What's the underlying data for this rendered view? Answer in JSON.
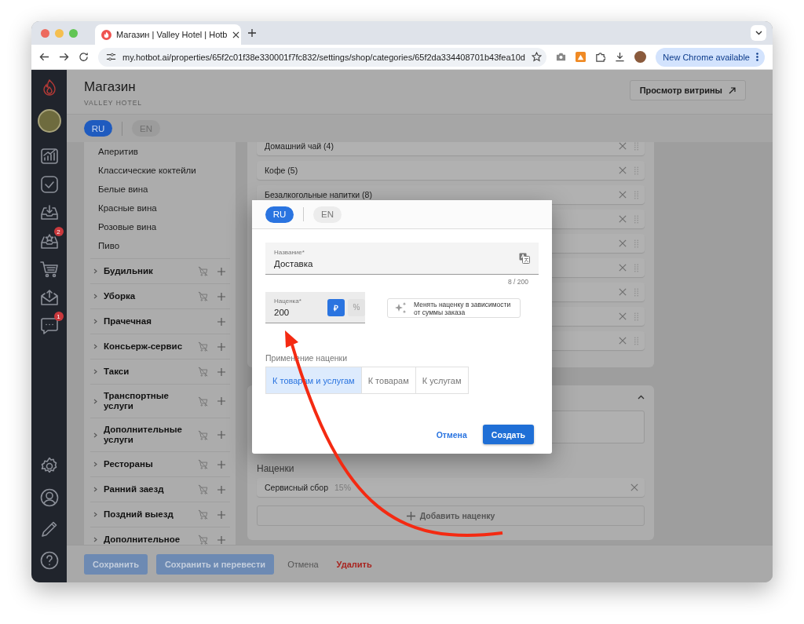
{
  "browser": {
    "tab_title": "Магазин | Valley Hotel | Hotb",
    "url": "my.hotbot.ai/properties/65f2c01f38e330001f7fc832/settings/shop/categories/65f2da334408701b43fea10d",
    "update_button": "New Chrome available"
  },
  "nav": {
    "top": [
      {
        "kind": "chart"
      },
      {
        "kind": "check"
      },
      {
        "kind": "inbox"
      },
      {
        "kind": "star-tray",
        "badge": "2"
      },
      {
        "kind": "cart"
      },
      {
        "kind": "mail"
      },
      {
        "kind": "chat",
        "badge": "1"
      }
    ],
    "bottom": [
      {
        "kind": "settings"
      },
      {
        "kind": "user"
      },
      {
        "kind": "pencil"
      },
      {
        "kind": "help"
      }
    ]
  },
  "header": {
    "title": "Магазин",
    "subtitle": "VALLEY HOTEL",
    "storefront_button": "Просмотр витрины"
  },
  "languages": [
    {
      "label": "RU",
      "selected": true
    },
    {
      "label": "EN",
      "selected": false
    }
  ],
  "categories": {
    "subitems": [
      "Аперитив",
      "Классические коктейли",
      "Белые вина",
      "Красные вина",
      "Розовые вина",
      "Пиво"
    ],
    "groups": [
      {
        "label": "Будильник",
        "hidden_in_shop": true
      },
      {
        "label": "Уборка",
        "hidden_in_shop": true
      },
      {
        "label": "Прачечная",
        "hidden_in_shop": false
      },
      {
        "label": "Консьерж-сервис",
        "hidden_in_shop": true
      },
      {
        "label": "Такси",
        "hidden_in_shop": true
      },
      {
        "label": "Транспортные услуги",
        "hidden_in_shop": true
      },
      {
        "label": "Дополнительные услуги",
        "hidden_in_shop": true
      },
      {
        "label": "Рестораны",
        "hidden_in_shop": true
      },
      {
        "label": "Ранний заезд",
        "hidden_in_shop": true
      },
      {
        "label": "Поздний выезд",
        "hidden_in_shop": true
      },
      {
        "label": "Дополнительное",
        "hidden_in_shop": true
      }
    ]
  },
  "subcategory_rows": [
    {
      "kind": "text",
      "label": "Домашний чай (4)"
    },
    {
      "kind": "text",
      "label": "Кофе (5)"
    },
    {
      "kind": "text",
      "label": "Безалкогольные напитки (8)"
    },
    {
      "kind": "covered"
    },
    {
      "kind": "covered"
    },
    {
      "kind": "covered"
    },
    {
      "kind": "covered"
    },
    {
      "kind": "covered"
    },
    {
      "kind": "covered"
    }
  ],
  "markups": {
    "title": "Наценки",
    "items": [
      {
        "name": "Сервисный сбор",
        "value": "15%"
      }
    ],
    "add_button": "Добавить наценку"
  },
  "footer": {
    "save": "Сохранить",
    "save_translate": "Сохранить и перевести",
    "cancel": "Отмена",
    "delete": "Удалить"
  },
  "modal": {
    "languages": [
      {
        "label": "RU",
        "selected": true
      },
      {
        "label": "EN",
        "selected": false
      }
    ],
    "name_field": {
      "label": "Название*",
      "value": "Доставка",
      "counter": "8 / 200"
    },
    "markup_field": {
      "label": "Наценка*",
      "value": "200",
      "units": [
        {
          "label": "₽",
          "selected": true
        },
        {
          "label": "%",
          "selected": false
        }
      ]
    },
    "tiered_button": "Менять наценку в зависимости от суммы заказа",
    "apply_label": "Применение наценки",
    "apply_options": [
      {
        "label": "К товарам и услугам",
        "selected": true
      },
      {
        "label": "К товарам",
        "selected": false
      },
      {
        "label": "К услугам",
        "selected": false
      }
    ],
    "cancel": "Отмена",
    "create": "Создать"
  }
}
